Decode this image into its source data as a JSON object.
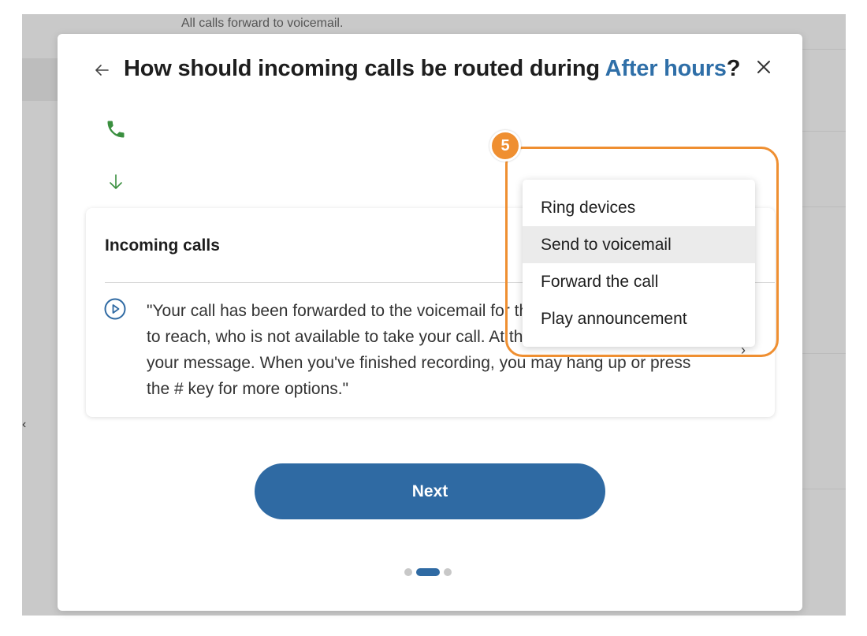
{
  "background": {
    "text": "All calls forward to voicemail."
  },
  "modal": {
    "title_prefix": "How should incoming calls be routed during ",
    "title_highlight": "After hours",
    "title_suffix": "?",
    "back_icon": "arrow-left-icon",
    "close_icon": "close-icon",
    "flow_icons": [
      "phone-icon",
      "arrow-down-icon"
    ]
  },
  "card": {
    "title": "Incoming calls",
    "message": "\"Your call has been forwarded to the voicemail for the person you're trying to reach, who is not available to take your call. At the tone, please record your message. When you've finished recording, you may hang up or press the # key for more options.\"",
    "play_icon": "play-circle-icon",
    "chevron": "›"
  },
  "dropdown": {
    "items": [
      {
        "label": "Ring devices"
      },
      {
        "label": "Send to voicemail",
        "hovered": true
      },
      {
        "label": "Forward the call"
      },
      {
        "label": "Play announcement"
      }
    ]
  },
  "annotation": {
    "step_number": "5"
  },
  "footer": {
    "next_label": "Next",
    "pager": {
      "total": 3,
      "current": 2
    }
  },
  "colors": {
    "accent": "#2f6aa3",
    "title_highlight": "#2f6fa8",
    "phone_green": "#3a8f3f",
    "annotation_orange": "#ef8f31"
  }
}
